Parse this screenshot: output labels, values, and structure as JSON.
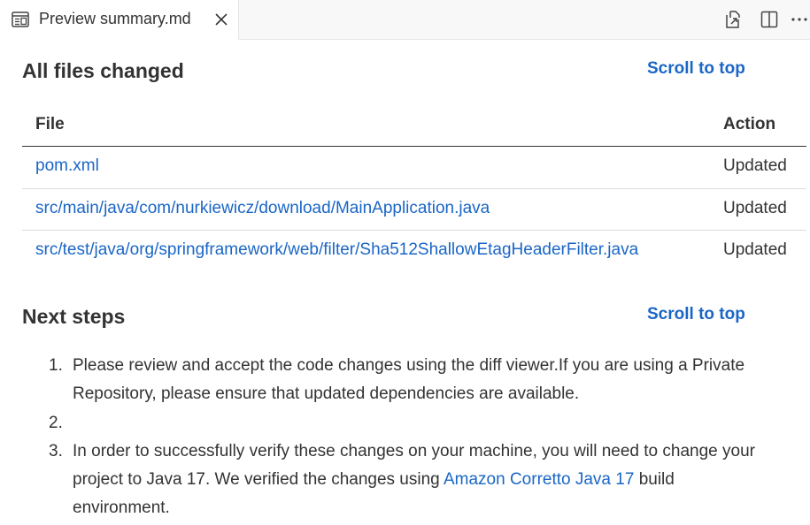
{
  "tab": {
    "label": "Preview summary.md",
    "icon": "markdown-preview-icon",
    "close_icon": "close-icon"
  },
  "toolbar": {
    "open_source_icon": "open-source-icon",
    "split_editor_icon": "split-editor-icon",
    "more_actions_icon": "more-actions-icon"
  },
  "section_files": {
    "heading": "All files changed",
    "scroll_link": "Scroll to top",
    "columns": [
      "File",
      "Action"
    ],
    "rows": [
      {
        "file": "pom.xml",
        "action": "Updated"
      },
      {
        "file": "src/main/java/com/nurkiewicz/download/MainApplication.java",
        "action": "Updated"
      },
      {
        "file": "src/test/java/org/springframework/web/filter/Sha512ShallowEtagHeaderFilter.java",
        "action": "Updated"
      }
    ]
  },
  "section_steps": {
    "heading": "Next steps",
    "scroll_link": "Scroll to top",
    "items": [
      {
        "num": "1.",
        "text": "Please review and accept the code changes using the diff viewer.If you are using a Private Repository, please ensure that updated dependencies are available."
      },
      {
        "num": "2.",
        "text": ""
      },
      {
        "num": "3.",
        "text_before": "In order to successfully verify these changes on your machine, you will need to change your project to Java 17. We verified the changes using ",
        "link": "Amazon Corretto Java 17",
        "text_after": " build environment."
      }
    ]
  },
  "colors": {
    "link": "#1a66c6",
    "text": "#333333",
    "tabbar_bg": "#f8f8f8"
  }
}
